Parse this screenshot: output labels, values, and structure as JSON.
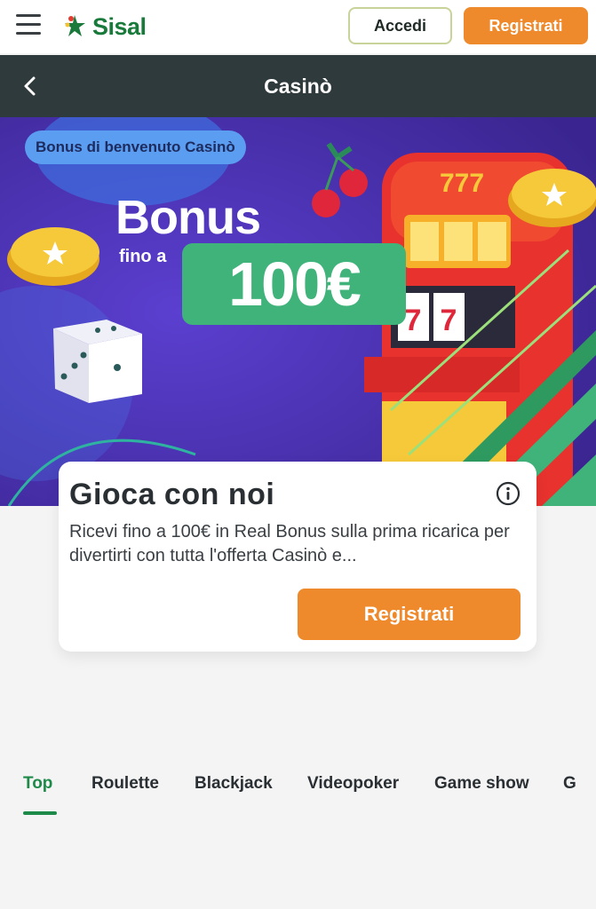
{
  "header": {
    "logo_text": "Sisal",
    "login_label": "Accedi",
    "register_label": "Registrati"
  },
  "titlebar": {
    "title": "Casinò"
  },
  "banner": {
    "pill_label": "Bonus di benvenuto Casinò",
    "bonus_word": "Bonus",
    "fino_a": "fino a",
    "amount": "100€",
    "slot_reels": "777"
  },
  "card": {
    "title": "Gioca con noi",
    "description": "Ricevi fino a 100€ in Real Bonus sulla prima ricarica per divertirti con tutta l'offerta Casinò e...",
    "cta_label": "Registrati"
  },
  "tabs": [
    {
      "label": "Top",
      "active": true
    },
    {
      "label": "Roulette",
      "active": false
    },
    {
      "label": "Blackjack",
      "active": false
    },
    {
      "label": "Videopoker",
      "active": false
    },
    {
      "label": "Game show",
      "active": false
    },
    {
      "label": "G",
      "active": false
    }
  ],
  "colors": {
    "brand_green": "#1e8a4a",
    "accent_orange": "#ee8a2c",
    "titlebar": "#2f3a3c"
  },
  "icons": [
    "hamburger-icon",
    "back-icon",
    "info-icon"
  ]
}
